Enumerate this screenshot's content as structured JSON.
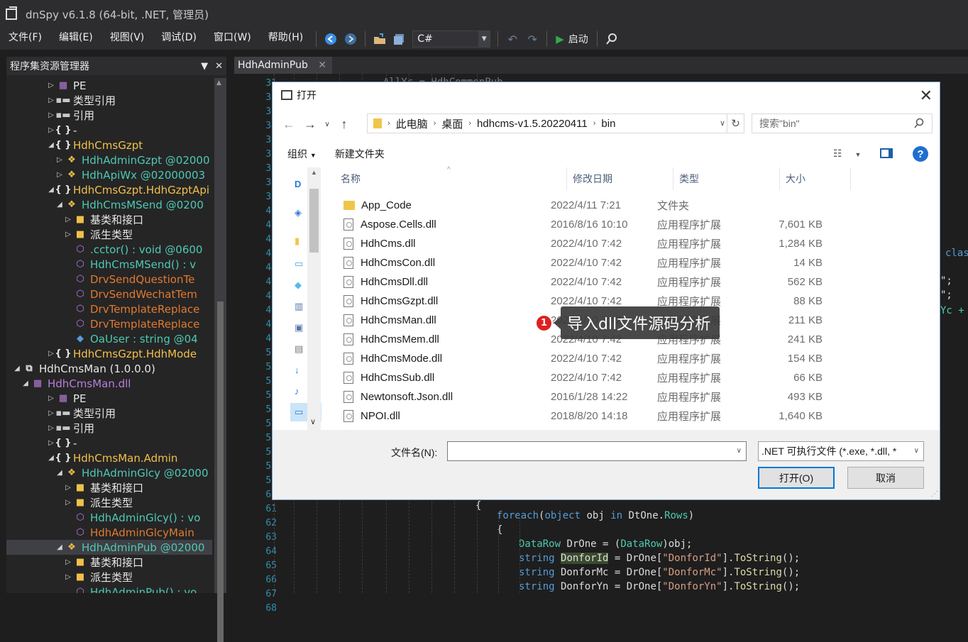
{
  "window": {
    "title": "dnSpy v6.1.8 (64-bit, .NET, 管理员)"
  },
  "menu": [
    "文件(F)",
    "编辑(E)",
    "视图(V)",
    "调试(D)",
    "窗口(W)",
    "帮助(H)"
  ],
  "toolbar": {
    "language": "C#",
    "start_label": "启动"
  },
  "assembly_panel": {
    "title": "程序集资源管理器",
    "tree": [
      {
        "indent": 5,
        "arrow": "▷",
        "icon": "pe-icon",
        "iconGlyph": "▦",
        "iconColor": "c-p",
        "text": "PE",
        "color": "c-w"
      },
      {
        "indent": 5,
        "arrow": "▷",
        "icon": "type-ref-icon",
        "iconGlyph": "▪▬",
        "iconColor": "c-g",
        "text": "类型引用",
        "color": "c-w"
      },
      {
        "indent": 5,
        "arrow": "▷",
        "icon": "reference-icon",
        "iconGlyph": "▪▬",
        "iconColor": "c-g",
        "text": "引用",
        "color": "c-w"
      },
      {
        "indent": 5,
        "arrow": "▷",
        "icon": "namespace-icon",
        "iconGlyph": "{ }",
        "iconColor": "c-w",
        "text": "-",
        "color": "c-w"
      },
      {
        "indent": 5,
        "arrow": "◢",
        "icon": "namespace-icon",
        "iconGlyph": "{ }",
        "iconColor": "c-w",
        "text": "HdhCmsGzpt",
        "color": "c-y"
      },
      {
        "indent": 6,
        "arrow": "▷",
        "icon": "class-icon",
        "iconGlyph": "❖",
        "iconColor": "c-y",
        "text": "HdhAdminGzpt @02000",
        "color": "c-t"
      },
      {
        "indent": 6,
        "arrow": "▷",
        "icon": "class-icon",
        "iconGlyph": "❖",
        "iconColor": "c-y",
        "text": "HdhApiWx @02000003",
        "color": "c-t"
      },
      {
        "indent": 5,
        "arrow": "◢",
        "icon": "namespace-icon",
        "iconGlyph": "{ }",
        "iconColor": "c-w",
        "text": "HdhCmsGzpt.HdhGzptApi",
        "color": "c-y"
      },
      {
        "indent": 6,
        "arrow": "◢",
        "icon": "class-icon",
        "iconGlyph": "❖",
        "iconColor": "c-y",
        "text": "HdhCmsMSend @0200",
        "color": "c-t"
      },
      {
        "indent": 7,
        "arrow": "▷",
        "icon": "folder-icon",
        "iconGlyph": "■",
        "iconColor": "c-y",
        "text": "基类和接口",
        "color": "c-w"
      },
      {
        "indent": 7,
        "arrow": "▷",
        "icon": "folder-icon",
        "iconGlyph": "■",
        "iconColor": "c-y",
        "text": "派生类型",
        "color": "c-w"
      },
      {
        "indent": 7,
        "arrow": "",
        "icon": "method-icon",
        "iconGlyph": "⬡",
        "iconColor": "c-p",
        "text": ".cctor() : void @0600",
        "color": "c-t"
      },
      {
        "indent": 7,
        "arrow": "",
        "icon": "method-icon",
        "iconGlyph": "⬡",
        "iconColor": "c-p",
        "text": "HdhCmsMSend() : v",
        "color": "c-t"
      },
      {
        "indent": 7,
        "arrow": "",
        "icon": "method-icon",
        "iconGlyph": "⬡",
        "iconColor": "c-p",
        "text": "DrvSendQuestionTe",
        "color": "c-o"
      },
      {
        "indent": 7,
        "arrow": "",
        "icon": "method-icon",
        "iconGlyph": "⬡",
        "iconColor": "c-p",
        "text": "DrvSendWechatTem",
        "color": "c-o"
      },
      {
        "indent": 7,
        "arrow": "",
        "icon": "method-icon",
        "iconGlyph": "⬡",
        "iconColor": "c-p",
        "text": "DrvTemplateReplace",
        "color": "c-o"
      },
      {
        "indent": 7,
        "arrow": "",
        "icon": "method-icon",
        "iconGlyph": "⬡",
        "iconColor": "c-p",
        "text": "DrvTemplateReplace",
        "color": "c-o"
      },
      {
        "indent": 7,
        "arrow": "",
        "icon": "field-icon",
        "iconGlyph": "◆",
        "iconColor": "c-b",
        "text": "OaUser : string @04",
        "color": "c-t"
      },
      {
        "indent": 5,
        "arrow": "▷",
        "icon": "namespace-icon",
        "iconGlyph": "{ }",
        "iconColor": "c-w",
        "text": "HdhCmsGzpt.HdhMode",
        "color": "c-y"
      },
      {
        "indent": 1,
        "arrow": "◢",
        "icon": "assembly-icon",
        "iconGlyph": "⧉",
        "iconColor": "c-w",
        "text": "HdhCmsMan (1.0.0.0)",
        "color": "c-w"
      },
      {
        "indent": 2,
        "arrow": "◢",
        "icon": "module-icon",
        "iconGlyph": "▦",
        "iconColor": "c-p",
        "text": "HdhCmsMan.dll",
        "color": "c-p"
      },
      {
        "indent": 5,
        "arrow": "▷",
        "icon": "pe-icon",
        "iconGlyph": "▦",
        "iconColor": "c-p",
        "text": "PE",
        "color": "c-w"
      },
      {
        "indent": 5,
        "arrow": "▷",
        "icon": "type-ref-icon",
        "iconGlyph": "▪▬",
        "iconColor": "c-g",
        "text": "类型引用",
        "color": "c-w"
      },
      {
        "indent": 5,
        "arrow": "▷",
        "icon": "reference-icon",
        "iconGlyph": "▪▬",
        "iconColor": "c-g",
        "text": "引用",
        "color": "c-w"
      },
      {
        "indent": 5,
        "arrow": "▷",
        "icon": "namespace-icon",
        "iconGlyph": "{ }",
        "iconColor": "c-w",
        "text": "-",
        "color": "c-w"
      },
      {
        "indent": 5,
        "arrow": "◢",
        "icon": "namespace-icon",
        "iconGlyph": "{ }",
        "iconColor": "c-w",
        "text": "HdhCmsMan.Admin",
        "color": "c-y"
      },
      {
        "indent": 6,
        "arrow": "◢",
        "icon": "class-icon",
        "iconGlyph": "❖",
        "iconColor": "c-y",
        "text": "HdhAdminGlcy @02000",
        "color": "c-t"
      },
      {
        "indent": 7,
        "arrow": "▷",
        "icon": "folder-icon",
        "iconGlyph": "■",
        "iconColor": "c-y",
        "text": "基类和接口",
        "color": "c-w"
      },
      {
        "indent": 7,
        "arrow": "▷",
        "icon": "folder-icon",
        "iconGlyph": "■",
        "iconColor": "c-y",
        "text": "派生类型",
        "color": "c-w"
      },
      {
        "indent": 7,
        "arrow": "",
        "icon": "method-icon",
        "iconGlyph": "⬡",
        "iconColor": "c-p",
        "text": "HdhAdminGlcy() : vo",
        "color": "c-t"
      },
      {
        "indent": 7,
        "arrow": "",
        "icon": "method-icon",
        "iconGlyph": "⬡",
        "iconColor": "c-p",
        "text": "HdhAdminGlcyMain",
        "color": "c-o"
      },
      {
        "indent": 6,
        "arrow": "◢",
        "icon": "class-icon",
        "iconGlyph": "❖",
        "iconColor": "c-y",
        "text": "HdhAdminPub @02000",
        "color": "c-t",
        "selected": true
      },
      {
        "indent": 7,
        "arrow": "▷",
        "icon": "folder-icon",
        "iconGlyph": "■",
        "iconColor": "c-y",
        "text": "基类和接口",
        "color": "c-w"
      },
      {
        "indent": 7,
        "arrow": "▷",
        "icon": "folder-icon",
        "iconGlyph": "■",
        "iconColor": "c-y",
        "text": "派生类型",
        "color": "c-w"
      },
      {
        "indent": 7,
        "arrow": "",
        "icon": "method-icon",
        "iconGlyph": "⬡",
        "iconColor": "c-p",
        "text": "HdhAdminPub() : vo",
        "color": "c-t"
      }
    ]
  },
  "editor": {
    "tab": "HdhAdminPub",
    "line_numbers": [
      "31",
      "32",
      "33",
      "34",
      "35",
      "36",
      "37",
      "38",
      "39",
      "40",
      "41",
      "42",
      "43",
      "44",
      "45",
      "46",
      "47",
      "48",
      "49",
      "50",
      "51",
      "52",
      "53",
      "54",
      "55",
      "56",
      "57",
      "58",
      "59",
      "60",
      "61",
      "62",
      "63",
      "64",
      "65",
      "66",
      "67",
      "68"
    ],
    "right_fragments": [
      "clas",
      "\";",
      "\";",
      "Yc +"
    ],
    "fragment_top": "AllYc = HdhCommonPub.",
    "brace": "{",
    "lines": [
      {
        "n": "63",
        "parts": [
          [
            "kw",
            "foreach"
          ],
          [
            "",
            "("
          ],
          [
            "kw",
            "object"
          ],
          [
            "",
            " obj "
          ],
          [
            "kw",
            "in"
          ],
          [
            "",
            " DtOne."
          ],
          [
            "ty",
            "Rows"
          ],
          [
            "",
            ")"
          ]
        ]
      },
      {
        "n": "64",
        "parts": [
          [
            "",
            "{"
          ]
        ]
      },
      {
        "n": "65",
        "parts": [
          [
            "ty",
            "DataRow"
          ],
          [
            "",
            " DrOne = ("
          ],
          [
            "ty",
            "DataRow"
          ],
          [
            "",
            ")obj;"
          ]
        ]
      },
      {
        "n": "66",
        "parts": [
          [
            "kw",
            "string"
          ],
          [
            "",
            " "
          ],
          [
            "hl",
            "DonforId"
          ],
          [
            "",
            " = DrOne["
          ],
          [
            "st",
            "\"DonforId\""
          ],
          [
            "",
            "]."
          ],
          [
            "me",
            "ToString"
          ],
          [
            "",
            "();"
          ]
        ]
      },
      {
        "n": "67",
        "parts": [
          [
            "kw",
            "string"
          ],
          [
            "",
            " DonforMc = DrOne["
          ],
          [
            "st",
            "\"DonforMc\""
          ],
          [
            "",
            "]."
          ],
          [
            "me",
            "ToString"
          ],
          [
            "",
            "();"
          ]
        ]
      },
      {
        "n": "68",
        "parts": [
          [
            "kw",
            "string"
          ],
          [
            "",
            " DonforYn = DrOne["
          ],
          [
            "st",
            "\"DonforYn\""
          ],
          [
            "",
            "]."
          ],
          [
            "me",
            "ToString"
          ],
          [
            "",
            "();"
          ]
        ]
      }
    ]
  },
  "dialog": {
    "title": "打开",
    "path": [
      "此电脑",
      "桌面",
      "hdhcms-v1.5.20220411",
      "bin"
    ],
    "search_placeholder": "搜索\"bin\"",
    "organize": "组织",
    "new_folder": "新建文件夹",
    "columns": [
      "名称",
      "修改日期",
      "类型",
      "大小"
    ],
    "files": [
      {
        "name": "App_Code",
        "date": "2022/4/11 7:21",
        "type": "文件夹",
        "size": "",
        "folder": true
      },
      {
        "name": "Aspose.Cells.dll",
        "date": "2016/8/16 10:10",
        "type": "应用程序扩展",
        "size": "7,601 KB"
      },
      {
        "name": "HdhCms.dll",
        "date": "2022/4/10 7:42",
        "type": "应用程序扩展",
        "size": "1,284 KB"
      },
      {
        "name": "HdhCmsCon.dll",
        "date": "2022/4/10 7:42",
        "type": "应用程序扩展",
        "size": "14 KB"
      },
      {
        "name": "HdhCmsDll.dll",
        "date": "2022/4/10 7:42",
        "type": "应用程序扩展",
        "size": "562 KB"
      },
      {
        "name": "HdhCmsGzpt.dll",
        "date": "2022/4/10 7:42",
        "type": "应用程序扩展",
        "size": "88 KB"
      },
      {
        "name": "HdhCmsMan.dll",
        "date": "2022/4/10 7:42",
        "type": "应用程序扩展",
        "size": "211 KB"
      },
      {
        "name": "HdhCmsMem.dll",
        "date": "2022/4/10 7:42",
        "type": "应用程序扩展",
        "size": "241 KB"
      },
      {
        "name": "HdhCmsMode.dll",
        "date": "2022/4/10 7:42",
        "type": "应用程序扩展",
        "size": "154 KB"
      },
      {
        "name": "HdhCmsSub.dll",
        "date": "2022/4/10 7:42",
        "type": "应用程序扩展",
        "size": "66 KB"
      },
      {
        "name": "Newtonsoft.Json.dll",
        "date": "2016/1/28 14:22",
        "type": "应用程序扩展",
        "size": "493 KB"
      },
      {
        "name": "NPOI.dll",
        "date": "2018/8/20 14:18",
        "type": "应用程序扩展",
        "size": "1,640 KB"
      }
    ],
    "filename_label": "文件名(N):",
    "filename_value": "",
    "filter": ".NET 可执行文件 (*.exe, *.dll, *",
    "open_button": "打开(O)",
    "cancel_button": "取消"
  },
  "annotation": {
    "badge": "1",
    "text": "导入dll文件源码分析"
  }
}
